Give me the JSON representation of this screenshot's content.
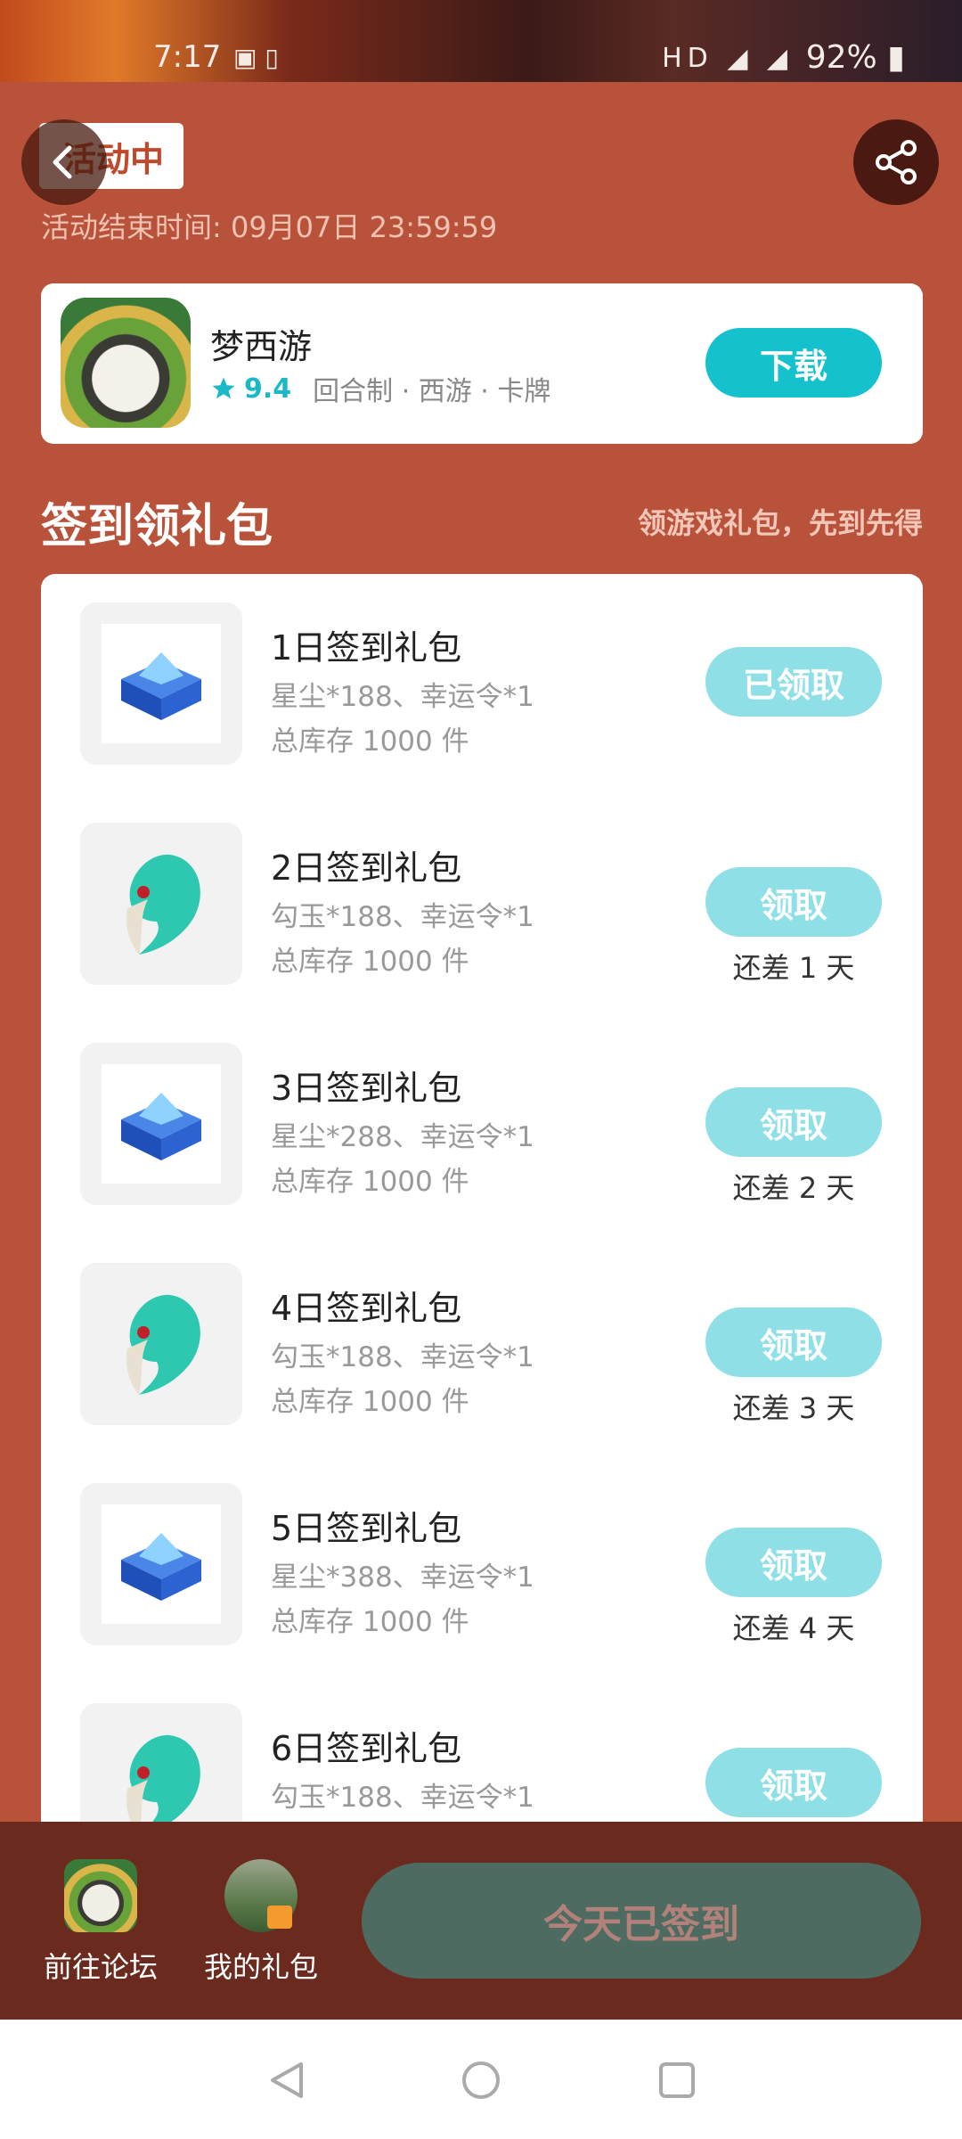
{
  "status_bar": {
    "time": "7:17",
    "battery": "92%"
  },
  "header": {
    "badge": "活动中",
    "end_time": "活动结束时间: 09月07日 23:59:59"
  },
  "game": {
    "name": "梦西游",
    "rating": "9.4",
    "tags": "回合制 · 西游 · 卡牌",
    "download_label": "下载"
  },
  "section": {
    "title": "签到领礼包",
    "subtitle": "领游戏礼包，先到先得"
  },
  "gifts": [
    {
      "title": "1日签到礼包",
      "desc": "星尘*188、幸运令*1",
      "stock": "总库存 1000 件",
      "button": "已领取",
      "remain": "",
      "icon": "chest-icon"
    },
    {
      "title": "2日签到礼包",
      "desc": "勾玉*188、幸运令*1",
      "stock": "总库存 1000 件",
      "button": "领取",
      "remain": "还差 1 天",
      "icon": "jade-icon"
    },
    {
      "title": "3日签到礼包",
      "desc": "星尘*288、幸运令*1",
      "stock": "总库存 1000 件",
      "button": "领取",
      "remain": "还差 2 天",
      "icon": "chest-icon"
    },
    {
      "title": "4日签到礼包",
      "desc": "勾玉*188、幸运令*1",
      "stock": "总库存 1000 件",
      "button": "领取",
      "remain": "还差 3 天",
      "icon": "jade-icon"
    },
    {
      "title": "5日签到礼包",
      "desc": "星尘*388、幸运令*1",
      "stock": "总库存 1000 件",
      "button": "领取",
      "remain": "还差 4 天",
      "icon": "chest-icon"
    },
    {
      "title": "6日签到礼包",
      "desc": "勾玉*188、幸运令*1",
      "stock": "",
      "button": "领取",
      "remain": "",
      "icon": "jade-icon"
    }
  ],
  "bottom": {
    "forum_label": "前往论坛",
    "mygift_label": "我的礼包",
    "signed_label": "今天已签到"
  },
  "colors": {
    "background": "#b9523a",
    "accent": "#15c1cd",
    "accent_light": "#8ee0e6",
    "bottom_bar": "#6a2a1d",
    "signed_button": "#4d6b60"
  }
}
